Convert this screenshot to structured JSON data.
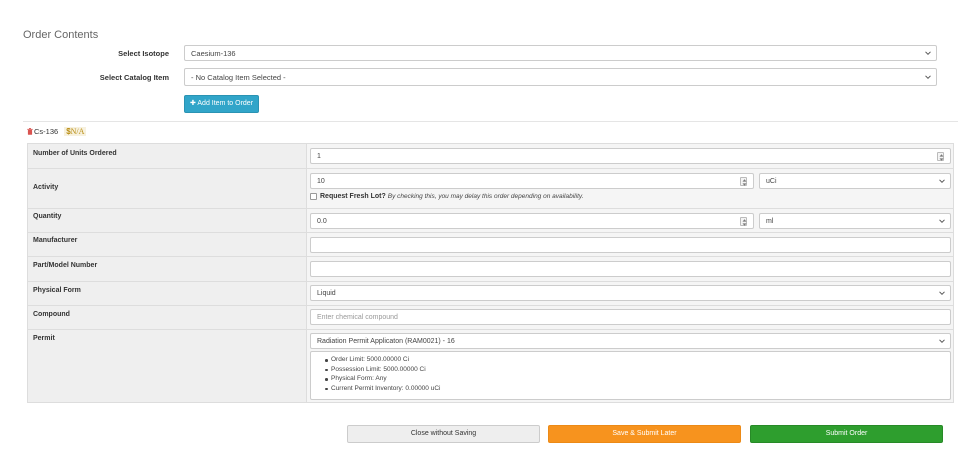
{
  "section_title": "Order Contents",
  "isotope": {
    "label": "Select Isotope",
    "selected": "Caesium-136"
  },
  "catalog": {
    "label": "Select Catalog Item",
    "selected": "- No Catalog Item Selected -"
  },
  "add_button_label": "✚ Add Item to Order",
  "item": {
    "name": "Cs-136",
    "price_symbol": "$",
    "price": "N/A"
  },
  "form": {
    "units": {
      "label": "Number of Units Ordered",
      "value": "1"
    },
    "activity": {
      "label": "Activity",
      "value": "10",
      "unit": "uCi",
      "fresh_lot_label": "Request Fresh Lot?",
      "fresh_lot_note": "By checking this, you may delay this order depending on availability."
    },
    "quantity": {
      "label": "Quantity",
      "value": "0.0",
      "unit": "ml"
    },
    "manufacturer": {
      "label": "Manufacturer",
      "value": ""
    },
    "part_model": {
      "label": "Part/Model Number",
      "value": ""
    },
    "physical_form": {
      "label": "Physical Form",
      "selected": "Liquid"
    },
    "compound": {
      "label": "Compound",
      "placeholder": "Enter chemical compound"
    },
    "permit": {
      "label": "Permit",
      "selected": "Radiation Permit Applicaton (RAM0021) - 16",
      "details": [
        "Order Limit: 5000.00000 Ci",
        "Possession Limit: 5000.00000 Ci",
        "Physical Form: Any",
        "Current Permit Inventory: 0.00000 uCi"
      ]
    }
  },
  "buttons": {
    "close": "Close without Saving",
    "later": "Save & Submit Later",
    "submit": "Submit Order"
  },
  "colors": {
    "add_button": "#31a5c9",
    "save_later": "#f7931e",
    "submit": "#2e9e2e",
    "trash_icon": "#d9534f",
    "price_badge": "#b98d12"
  }
}
